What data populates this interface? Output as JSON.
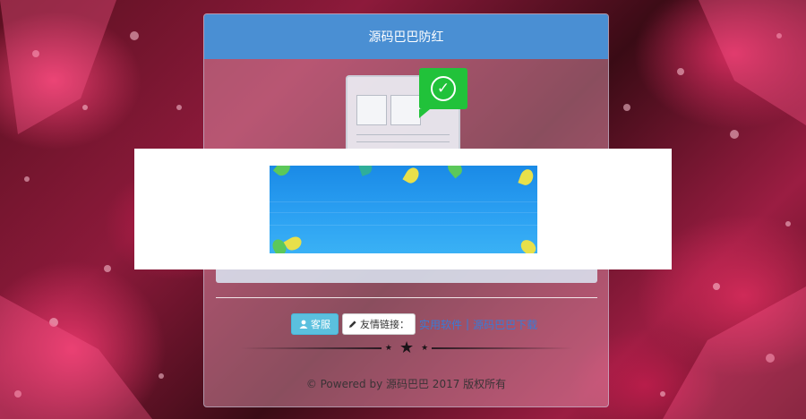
{
  "page": {
    "header_title": "源码巴巴防红"
  },
  "actions": {
    "service_button": "客服",
    "links_button": "友情链接：",
    "link_software": "实用软件",
    "separator": "|",
    "link_download": "源码巴巴下载"
  },
  "footer": {
    "text": "© Powered by 源码巴巴 2017 版权所有"
  },
  "icons": {
    "check": "check-circle-icon",
    "user": "user-icon",
    "pencil": "pencil-icon",
    "star": "star-icon"
  },
  "colors": {
    "header_bg": "#4a8fd3",
    "check_bubble": "#21c23a",
    "service_button_bg": "#5bc0de",
    "banner_blue": "#2ba0f2",
    "link": "#3a7bd5"
  }
}
